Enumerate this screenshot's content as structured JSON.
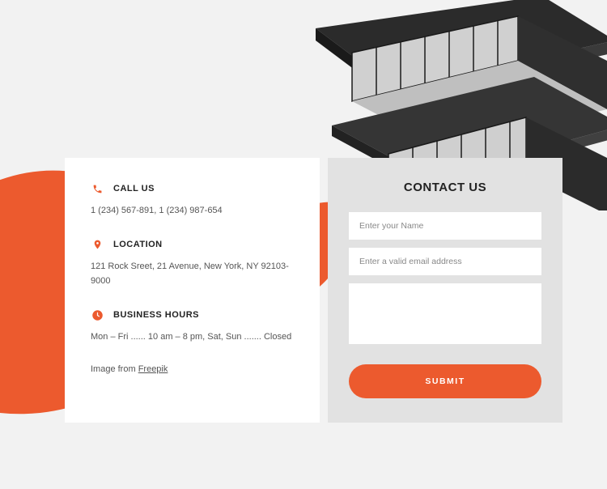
{
  "colors": {
    "accent": "#ec5a2e"
  },
  "info": {
    "call": {
      "title": "CALL US",
      "text": "1 (234) 567-891, 1 (234) 987-654"
    },
    "location": {
      "title": "LOCATION",
      "text": "121 Rock Sreet, 21 Avenue, New York, NY 92103-9000"
    },
    "hours": {
      "title": "BUSINESS HOURS",
      "text": "Mon – Fri ...... 10 am – 8 pm, Sat, Sun ....... Closed"
    },
    "credit_prefix": "Image from ",
    "credit_link": "Freepik"
  },
  "form": {
    "title": "CONTACT US",
    "name_placeholder": "Enter your Name",
    "email_placeholder": "Enter a valid email address",
    "submit_label": "SUBMIT"
  }
}
